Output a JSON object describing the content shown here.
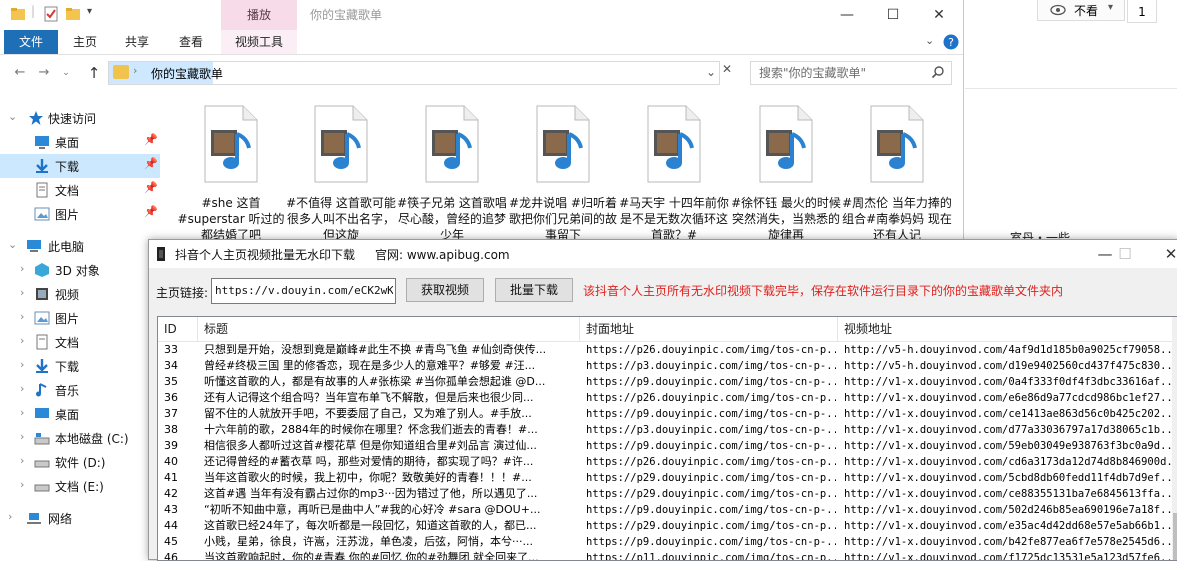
{
  "explorer": {
    "context_tab_group": "播放",
    "window_title": "你的宝藏歌单",
    "ribbon_tabs": [
      "文件",
      "主页",
      "共享",
      "查看",
      "视频工具"
    ],
    "address": {
      "path": "你的宝藏歌单"
    },
    "search": {
      "placeholder": "搜索\"你的宝藏歌单\""
    },
    "sidebar": {
      "quick_access": "快速访问",
      "items": [
        {
          "label": "桌面",
          "icon": "desktop-icon",
          "pinned": true
        },
        {
          "label": "下载",
          "icon": "download-icon",
          "pinned": true,
          "selected": true
        },
        {
          "label": "文档",
          "icon": "document-icon",
          "pinned": true
        },
        {
          "label": "图片",
          "icon": "picture-icon",
          "pinned": true
        }
      ],
      "this_pc": "此电脑",
      "pc_items": [
        {
          "label": "3D 对象",
          "icon": "3d-objects-icon"
        },
        {
          "label": "视频",
          "icon": "video-folder-icon"
        },
        {
          "label": "图片",
          "icon": "picture-icon"
        },
        {
          "label": "文档",
          "icon": "document-icon"
        },
        {
          "label": "下载",
          "icon": "download-icon"
        },
        {
          "label": "音乐",
          "icon": "music-icon"
        },
        {
          "label": "桌面",
          "icon": "desktop-icon"
        },
        {
          "label": "本地磁盘 (C:)",
          "icon": "local-disk-icon"
        },
        {
          "label": "软件 (D:)",
          "icon": "drive-icon"
        },
        {
          "label": "文档 (E:)",
          "icon": "drive-icon"
        }
      ],
      "network": "网络"
    },
    "files": [
      {
        "name": "#she 这首 #superstar 听过的都结婚了吧"
      },
      {
        "name": "#不值得 这首歌可能很多人叫不出名字，但这旋"
      },
      {
        "name": "#筷子兄弟 这首歌唱尽心酸，曾经的追梦少年"
      },
      {
        "name": "#龙井说唱 #归听着歌把你们兄弟间的故事留下"
      },
      {
        "name": "#马天宇 十四年前你是不是无数次循环这首歌？#"
      },
      {
        "name": "#徐怀钰 最火的时候突然消失，当熟悉的旋律再"
      },
      {
        "name": "#周杰伦 当年力捧的组合#南拳妈妈 现在还有人记"
      }
    ]
  },
  "right_pane": {
    "view_button": "不看",
    "count_button": "1",
    "partial_text": "室丹・一些"
  },
  "downloader": {
    "title": "抖音个人主页视频批量无水印下载",
    "site_label": "官网: www.apibug.com",
    "url_label": "主页链接:",
    "url_value": "https://v.douyin.com/eCK2wKA/",
    "fetch_button": "获取视频",
    "batch_button": "批量下载",
    "status": "该抖音个人主页所有无水印视频下载完毕，保存在软件运行目录下的你的宝藏歌单文件夹内",
    "columns": [
      "ID",
      "标题",
      "封面地址",
      "视频地址"
    ],
    "rows": [
      {
        "id": "33",
        "title": "只想到是开始，没想到竟是巅峰#此生不换 #青鸟飞鱼 #仙剑奇侠传...",
        "cover": "https://p26.douyinpic.com/img/tos-cn-p...",
        "video": "http://v5-h.douyinvod.com/4af9d1d185b0a9025cf79058..."
      },
      {
        "id": "34",
        "title": "曾经#终极三国 里的修香恋，现在是多少人的意难平？#够爱 #汪...",
        "cover": "https://p3.douyinpic.com/img/tos-cn-p-...",
        "video": "http://v5-h.douyinvod.com/d19e9402560cd437f475c830..."
      },
      {
        "id": "35",
        "title": "听懂这首歌的人，都是有故事的人#张栋梁 #当你孤单会想起谁 @D...",
        "cover": "https://p9.douyinpic.com/img/tos-cn-p-...",
        "video": "http://v1-x.douyinvod.com/0a4f333f0df4f3dbc33616af..."
      },
      {
        "id": "36",
        "title": "还有人记得这个组合吗？当年宣布单飞不解散，但是后来也很少同...",
        "cover": "https://p26.douyinpic.com/img/tos-cn-p...",
        "video": "http://v1-x.douyinvod.com/e6e86d9a77cdcd986bc1ef27..."
      },
      {
        "id": "37",
        "title": "留不住的人就放开手吧，不要委屈了自己，又为难了别人。#手放...",
        "cover": "https://p9.douyinpic.com/img/tos-cn-p-...",
        "video": "http://v1-x.douyinvod.com/ce1413ae863d56c0b425c202..."
      },
      {
        "id": "38",
        "title": "十六年前的歌，2884年的时候你在哪里？怀念我们逝去的青春！#...",
        "cover": "https://p3.douyinpic.com/img/tos-cn-p-...",
        "video": "http://v1-x.douyinvod.com/d77a33036797a17d38065c1b..."
      },
      {
        "id": "39",
        "title": "相信很多人都听过这首#樱花草 但是你知道组合里#刘品言 演过仙...",
        "cover": "https://p9.douyinpic.com/img/tos-cn-p-...",
        "video": "http://v1-x.douyinvod.com/59eb03049e938763f3bc0a9d..."
      },
      {
        "id": "40",
        "title": "还记得曾经的#蓄衣草 吗，那些对爱情的期待，都实现了吗？#许...",
        "cover": "https://p26.douyinpic.com/img/tos-cn-p...",
        "video": "http://v1-x.douyinvod.com/cd6a3173da12d74d8b846900d..."
      },
      {
        "id": "41",
        "title": "当年这首歌火的时候，我上初中，你呢？致敬美好的青春！！！#...",
        "cover": "https://p29.douyinpic.com/img/tos-cn-p...",
        "video": "http://v1-x.douyinvod.com/5cbd8db60fedd11f4db7d9ef..."
      },
      {
        "id": "42",
        "title": "这首#遇 当年有没有霸占过你的mp3···因为错过了他，所以遇见了...",
        "cover": "https://p29.douyinpic.com/img/tos-cn-p...",
        "video": "http://v1-x.douyinvod.com/ce88355131ba7e6845613ffa..."
      },
      {
        "id": "43",
        "title": "“初听不知曲中意，再听已是曲中人”#我的心好冷 #sara @DOU+...",
        "cover": "https://p9.douyinpic.com/img/tos-cn-p-...",
        "video": "http://v1-x.douyinvod.com/502d246b85ea690196e7a18f..."
      },
      {
        "id": "44",
        "title": "这首歌已经24年了，每次听都是一段回忆，知道这首歌的人，都已...",
        "cover": "https://p29.douyinpic.com/img/tos-cn-p...",
        "video": "http://v1-x.douyinvod.com/e35ac4d42dd68e57e5ab66b1..."
      },
      {
        "id": "45",
        "title": "小贱，星弟，徐良，许嵩，汪苏泷，单色凌，后弦，阿悄，本兮···...",
        "cover": "https://p9.douyinpic.com/img/tos-cn-p-...",
        "video": "http://v1-x.douyinvod.com/b42fe877ea6f7e578e2545d6..."
      },
      {
        "id": "46",
        "title": "当这首歌响起时，你的#青春 你的#回忆 你的#劲舞团 就全回来了...",
        "cover": "https://p11.douyinpic.com/img/tos-cn-p...",
        "video": "http://v1-x.douyinvod.com/f1725dc13531e5a123d57fe6..."
      }
    ]
  }
}
